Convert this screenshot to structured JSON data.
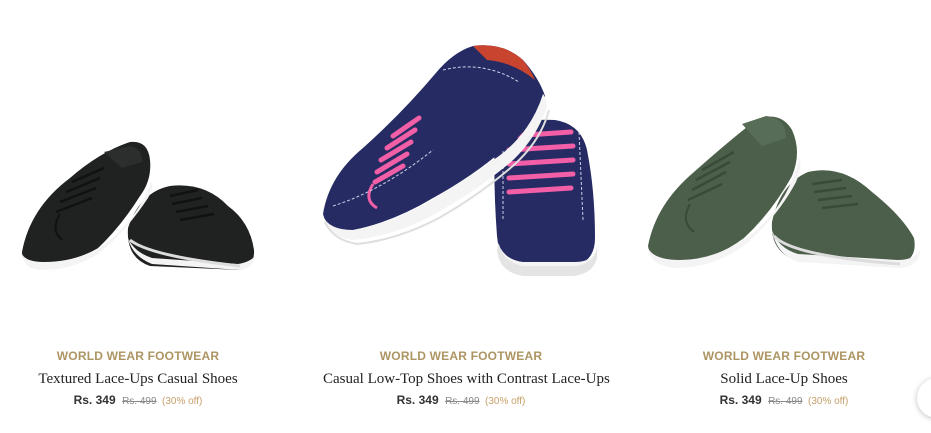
{
  "products": [
    {
      "brand": "WORLD WEAR FOOTWEAR",
      "title": "Textured Lace-Ups Casual Shoes",
      "price": "Rs. 349",
      "mrp": "Rs. 499",
      "discount": "(30% off)",
      "image": "black-canvas-sneakers",
      "colors": {
        "upper": "#1f2220",
        "sole": "#f4f4f4",
        "lace": "#111111"
      }
    },
    {
      "brand": "WORLD WEAR FOOTWEAR",
      "title": "Casual Low-Top Shoes with Contrast Lace-Ups",
      "price": "Rs. 349",
      "mrp": "Rs. 499",
      "discount": "(30% off)",
      "image": "navy-denim-sneakers-pink-laces",
      "colors": {
        "upper": "#262b63",
        "sole": "#f4f4f4",
        "lace": "#f25fa6",
        "lining": "#c8442f"
      }
    },
    {
      "brand": "WORLD WEAR FOOTWEAR",
      "title": "Solid Lace-Up Shoes",
      "price": "Rs. 349",
      "mrp": "Rs. 499",
      "discount": "(30% off)",
      "image": "olive-green-sneakers",
      "colors": {
        "upper": "#4c5f4b",
        "sole": "#f4f4f4",
        "lace": "#3a4a39"
      }
    }
  ],
  "theme": {
    "brand_color": "#ad9563",
    "discount_color": "#c7a06a"
  },
  "carousel": {
    "next_icon": "chevron-right-icon"
  }
}
